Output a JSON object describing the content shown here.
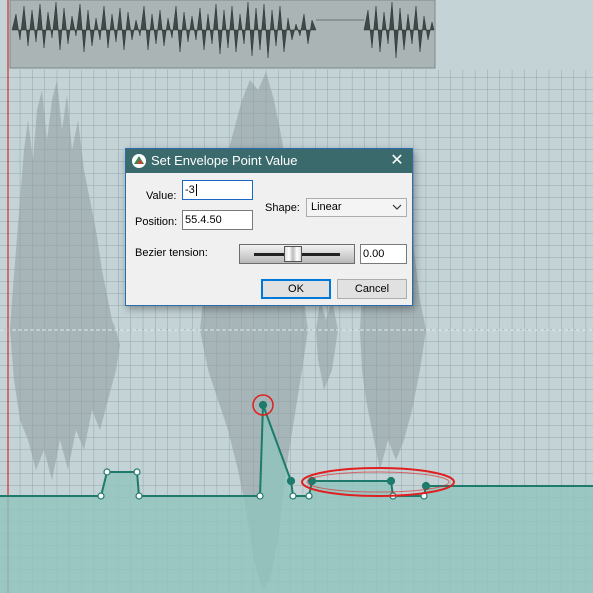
{
  "dialog": {
    "title": "Set Envelope Point Value",
    "close_glyph": "✕",
    "value_label": "Value:",
    "value": "-3",
    "position_label": "Position:",
    "position": "55.4.50",
    "shape_label": "Shape:",
    "shape": "Linear",
    "bezier_label": "Bezier tension:",
    "bezier_value": "0.00",
    "ok_label": "OK",
    "cancel_label": "Cancel"
  },
  "icons": {
    "title": "reaper-logo-icon",
    "close": "close-icon",
    "chevron": "chevron-down-icon"
  },
  "colors": {
    "envelope_line": "#1e7a6a",
    "envelope_fill": "#90c4bd",
    "annotation": "#e02020",
    "titlebar": "#3a6a6c",
    "background": "#c4d3d6"
  }
}
